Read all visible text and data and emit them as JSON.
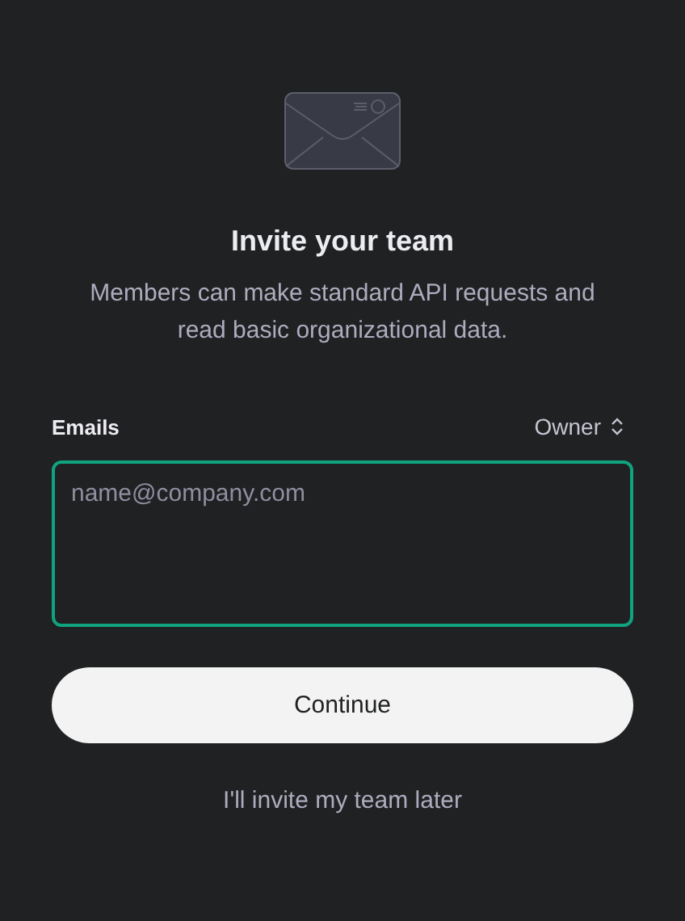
{
  "title": "Invite your team",
  "subtitle": "Members can make standard API requests and read basic organizational data.",
  "emails": {
    "label": "Emails",
    "placeholder": "name@company.com",
    "focused": true
  },
  "role": {
    "value": "Owner"
  },
  "primary_button": "Continue",
  "skip_link": "I'll invite my team later"
}
